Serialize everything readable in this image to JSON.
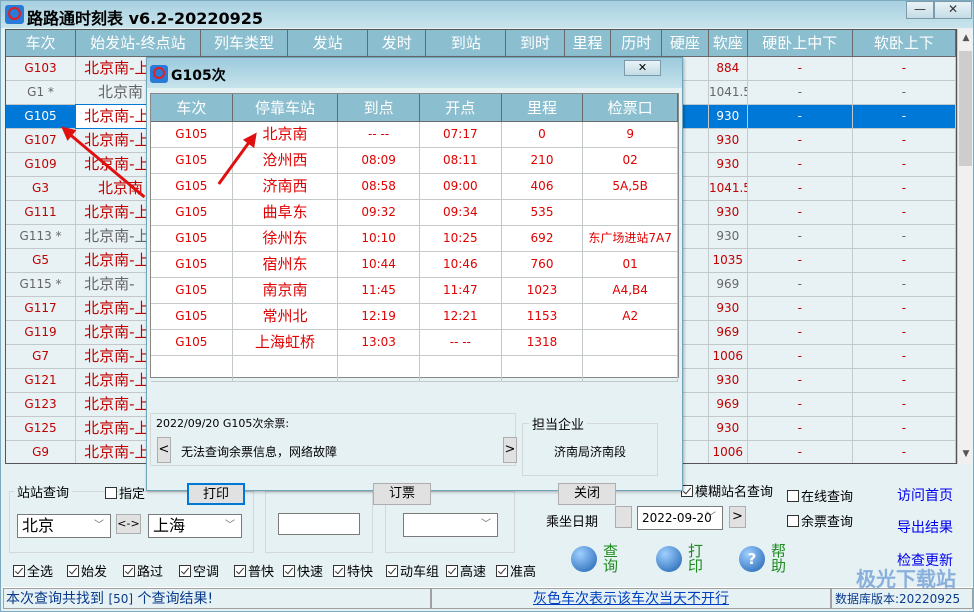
{
  "app": {
    "title": "路路通时刻表 v6.2-20220925",
    "minimize_glyph": "—",
    "close_glyph": "✕"
  },
  "grid": {
    "columns": [
      "车次",
      "始发站-终点站",
      "列车类型",
      "发站",
      "发时",
      "到站",
      "到时",
      "里程",
      "历时",
      "硬座",
      "软座",
      "硬卧上中下",
      "软卧上下"
    ],
    "rows": [
      {
        "train": "G103",
        "route": "北京南-上",
        "soft_seat": "884",
        "hard_sleeper": "-",
        "soft_sleeper": "-",
        "style": "red"
      },
      {
        "train": "G1 *",
        "route": "北京南",
        "soft_seat": "1041.5",
        "hard_sleeper": "-",
        "soft_sleeper": "-",
        "style": "gray"
      },
      {
        "train": "G105",
        "route": "北京南-上",
        "soft_seat": "930",
        "hard_sleeper": "-",
        "soft_sleeper": "-",
        "style": "sel"
      },
      {
        "train": "G107",
        "route": "北京南-上",
        "soft_seat": "930",
        "hard_sleeper": "-",
        "soft_sleeper": "-",
        "style": "red"
      },
      {
        "train": "G109",
        "route": "北京南-上",
        "soft_seat": "930",
        "hard_sleeper": "-",
        "soft_sleeper": "-",
        "style": "red"
      },
      {
        "train": "G3",
        "route": "北京南",
        "soft_seat": "1041.5",
        "hard_sleeper": "-",
        "soft_sleeper": "-",
        "style": "red"
      },
      {
        "train": "G111",
        "route": "北京南-上",
        "soft_seat": "930",
        "hard_sleeper": "-",
        "soft_sleeper": "-",
        "style": "red"
      },
      {
        "train": "G113 *",
        "route": "北京南-上",
        "soft_seat": "930",
        "hard_sleeper": "-",
        "soft_sleeper": "-",
        "style": "gray"
      },
      {
        "train": "G5",
        "route": "北京南-上",
        "soft_seat": "1035",
        "hard_sleeper": "-",
        "soft_sleeper": "-",
        "style": "red"
      },
      {
        "train": "G115 *",
        "route": "北京南-",
        "soft_seat": "969",
        "hard_sleeper": "-",
        "soft_sleeper": "-",
        "style": "gray"
      },
      {
        "train": "G117",
        "route": "北京南-上",
        "soft_seat": "930",
        "hard_sleeper": "-",
        "soft_sleeper": "-",
        "style": "red"
      },
      {
        "train": "G119",
        "route": "北京南-上",
        "soft_seat": "969",
        "hard_sleeper": "-",
        "soft_sleeper": "-",
        "style": "red"
      },
      {
        "train": "G7",
        "route": "北京南-上",
        "soft_seat": "1006",
        "hard_sleeper": "-",
        "soft_sleeper": "-",
        "style": "red"
      },
      {
        "train": "G121",
        "route": "北京南-上",
        "soft_seat": "930",
        "hard_sleeper": "-",
        "soft_sleeper": "-",
        "style": "red"
      },
      {
        "train": "G123",
        "route": "北京南-上",
        "soft_seat": "969",
        "hard_sleeper": "-",
        "soft_sleeper": "-",
        "style": "red"
      },
      {
        "train": "G125",
        "route": "北京南-上",
        "soft_seat": "930",
        "hard_sleeper": "-",
        "soft_sleeper": "-",
        "style": "red"
      },
      {
        "train": "G9",
        "route": "北京南-上",
        "soft_seat": "1006",
        "hard_sleeper": "-",
        "soft_sleeper": "-",
        "style": "red"
      }
    ]
  },
  "search": {
    "group_label": "站站查询",
    "specify_label": "指定",
    "from_value": "北京",
    "swap_label": "<->",
    "to_value": "上海",
    "fuzzy_label": "模糊站名查询",
    "date_label": "乘坐日期",
    "date_value": "2022-09-20",
    "date_prev": "<",
    "date_next": ">",
    "online_label": "在线查询",
    "remain_label": "余票查询"
  },
  "filters": [
    {
      "label": "全选",
      "checked": true
    },
    {
      "label": "始发",
      "checked": true
    },
    {
      "label": "路过",
      "checked": true
    },
    {
      "label": "空调",
      "checked": true
    },
    {
      "label": "普快",
      "checked": true
    },
    {
      "label": "快速",
      "checked": true
    },
    {
      "label": "特快",
      "checked": true
    },
    {
      "label": "动车组",
      "checked": true
    },
    {
      "label": "高速",
      "checked": true
    },
    {
      "label": "准高",
      "checked": true
    }
  ],
  "actions": {
    "query": "查询",
    "print": "打印",
    "help": "帮助",
    "help_glyph": "?"
  },
  "links": {
    "home": "访问首页",
    "export": "导出结果",
    "update": "检查更新"
  },
  "status": {
    "result_prefix": "本次查询共找到 ",
    "result_count": "[50]",
    "result_suffix": " 个查询结果!",
    "hint": "灰色车次表示该车次当天不开行",
    "db_version": "数据库版本:20220925"
  },
  "watermark": "极光下载站",
  "dialog": {
    "title": "G105次",
    "close_glyph": "✕",
    "columns": [
      "车次",
      "停靠车站",
      "到点",
      "开点",
      "里程",
      "检票口"
    ],
    "stops": [
      {
        "train": "G105",
        "station": "北京南",
        "arrive": "-- --",
        "depart": "07:17",
        "distance": "0",
        "gate": "9"
      },
      {
        "train": "G105",
        "station": "沧州西",
        "arrive": "08:09",
        "depart": "08:11",
        "distance": "210",
        "gate": "02"
      },
      {
        "train": "G105",
        "station": "济南西",
        "arrive": "08:58",
        "depart": "09:00",
        "distance": "406",
        "gate": "5A,5B"
      },
      {
        "train": "G105",
        "station": "曲阜东",
        "arrive": "09:32",
        "depart": "09:34",
        "distance": "535",
        "gate": ""
      },
      {
        "train": "G105",
        "station": "徐州东",
        "arrive": "10:10",
        "depart": "10:25",
        "distance": "692",
        "gate": "东广场进站7A7"
      },
      {
        "train": "G105",
        "station": "宿州东",
        "arrive": "10:44",
        "depart": "10:46",
        "distance": "760",
        "gate": "01"
      },
      {
        "train": "G105",
        "station": "南京南",
        "arrive": "11:45",
        "depart": "11:47",
        "distance": "1023",
        "gate": "A4,B4"
      },
      {
        "train": "G105",
        "station": "常州北",
        "arrive": "12:19",
        "depart": "12:21",
        "distance": "1153",
        "gate": "A2"
      },
      {
        "train": "G105",
        "station": "上海虹桥",
        "arrive": "13:03",
        "depart": "-- --",
        "distance": "1318",
        "gate": ""
      }
    ],
    "ticket_group_label": "2022/09/20 G105次余票:",
    "ticket_message": "无法查询余票信息，网络故障",
    "prev_glyph": "<",
    "next_glyph": ">",
    "operator_label": "担当企业",
    "operator_value": "济南局济南段",
    "print_button": "打印",
    "book_button": "订票",
    "close_button": "关闭"
  },
  "colors": {
    "accent": "#0078d7",
    "header": "#8bbfd0",
    "train_red": "#c00000",
    "link": "#0000ee",
    "green_label": "#1e8c1e"
  }
}
